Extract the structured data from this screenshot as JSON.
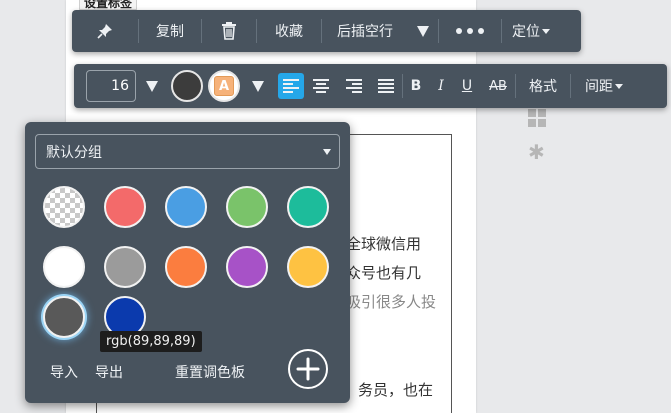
{
  "document": {
    "tag_label": "设置标签",
    "lines": [
      "全球微信用",
      "众号也有几",
      "吸引很多人投",
      "务员，也在"
    ]
  },
  "toolbar_top": {
    "copy": "复制",
    "favorite": "收藏",
    "insert_blank": "后插空行",
    "locate": "定位"
  },
  "toolbar_format": {
    "font_size": "16",
    "font_color": "#3c3c3c",
    "bold": "B",
    "italic": "I",
    "underline": "U",
    "strikethrough": "AB",
    "format": "格式",
    "spacing": "间距",
    "bg_letter": "A"
  },
  "palette": {
    "group": "默认分组",
    "colors": [
      "transparent",
      "#f36a6a",
      "#4a9ee3",
      "#7ac36a",
      "#1dbc9b",
      "#ffffff",
      "#9b9b9b",
      "#fb7d3f",
      "#a752c7",
      "#fec242",
      "#595959",
      "#0b3aad"
    ],
    "tooltip": "rgb(89,89,89)",
    "import": "导入",
    "export": "导出",
    "reset": "重置调色板"
  }
}
